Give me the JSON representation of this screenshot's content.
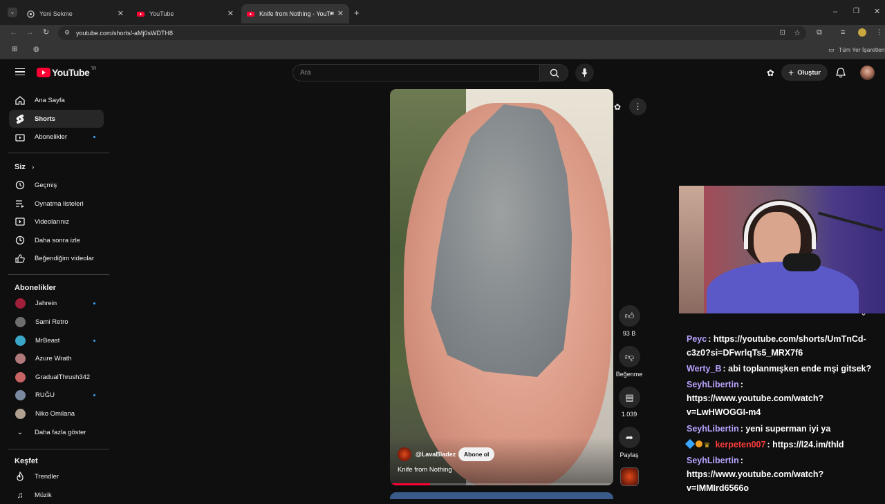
{
  "browser": {
    "tabs": [
      {
        "title": "Yeni Sekme"
      },
      {
        "title": "YouTube"
      },
      {
        "title": "Knife from Nothing - YouTu"
      }
    ],
    "url": "youtube.com/shorts/-aMj0sWDTH8",
    "bookmarks_label": "Tüm Yer İşaretleri"
  },
  "youtube": {
    "logo": "YouTube",
    "region": "TR",
    "search_placeholder": "Ara",
    "create_label": "Oluştur",
    "sidebar": {
      "main": [
        {
          "label": "Ana Sayfa",
          "icon": "home-icon"
        },
        {
          "label": "Shorts",
          "icon": "shorts-icon"
        },
        {
          "label": "Abonelikler",
          "icon": "subscriptions-icon"
        }
      ],
      "you_title": "Siz",
      "you": [
        {
          "label": "Geçmiş",
          "icon": "history-icon"
        },
        {
          "label": "Oynatma listeleri",
          "icon": "playlists-icon"
        },
        {
          "label": "Videolarınız",
          "icon": "your-videos-icon"
        },
        {
          "label": "Daha sonra izle",
          "icon": "watch-later-icon"
        },
        {
          "label": "Beğendiğim videolar",
          "icon": "liked-icon"
        }
      ],
      "subs_title": "Abonelikler",
      "subs": [
        {
          "label": "Jahrein",
          "color": "#a0203a"
        },
        {
          "label": "Sami Retro",
          "color": "#6e6e6e"
        },
        {
          "label": "MrBeast",
          "color": "#3aa7c9"
        },
        {
          "label": "Azure Wrath",
          "color": "#b07a7a"
        },
        {
          "label": "GradualThrush342",
          "color": "#c86464"
        },
        {
          "label": "RUĞU",
          "color": "#7a8aa0"
        },
        {
          "label": "Niko Omilana",
          "color": "#b0a090"
        },
        {
          "label": "Daha fazla göster",
          "color": ""
        }
      ],
      "explore_title": "Keşfet",
      "explore": [
        {
          "label": "Trendler",
          "icon": "trending-icon"
        },
        {
          "label": "Müzik",
          "icon": "music-icon"
        }
      ]
    },
    "short": {
      "channel": "@LavaBladez",
      "subscribe_label": "Abone ol",
      "title": "Knife from Nothing",
      "progress": 0.18,
      "likes": "93 B",
      "dislike_label": "Beğenme",
      "comments": "1.039",
      "share_label": "Paylaş"
    }
  },
  "chat": [
    {
      "user": "Peyc",
      "color": "#b9a3ff",
      "text": ": https://youtube.com/shorts/UmTnCd-",
      "cont": "c3z0?si=DFwrlqTs5_MRX7f6"
    },
    {
      "user": "Werty_B",
      "color": "#b9a3ff",
      "text": ": abi toplanmışken ende mşi gitsek?",
      "cont": ""
    },
    {
      "user": "SeyhLibertin",
      "color": "#b9a3ff",
      "text": ":",
      "cont": "https://www.youtube.com/watch?",
      "cont2": "v=LwHWOGGI-m4"
    },
    {
      "user": "SeyhLibertin",
      "color": "#b9a3ff",
      "text": ": yeni superman iyi ya",
      "cont": ""
    },
    {
      "user": "kerpeten007",
      "color": "#ff3b3b",
      "text": ": https://l24.im/thld",
      "cont": ""
    },
    {
      "user": "SeyhLibertin",
      "color": "#b9a3ff",
      "text": ":",
      "cont": "https://www.youtube.com/watch?",
      "cont2": "v=IMMIrd6566o"
    }
  ]
}
